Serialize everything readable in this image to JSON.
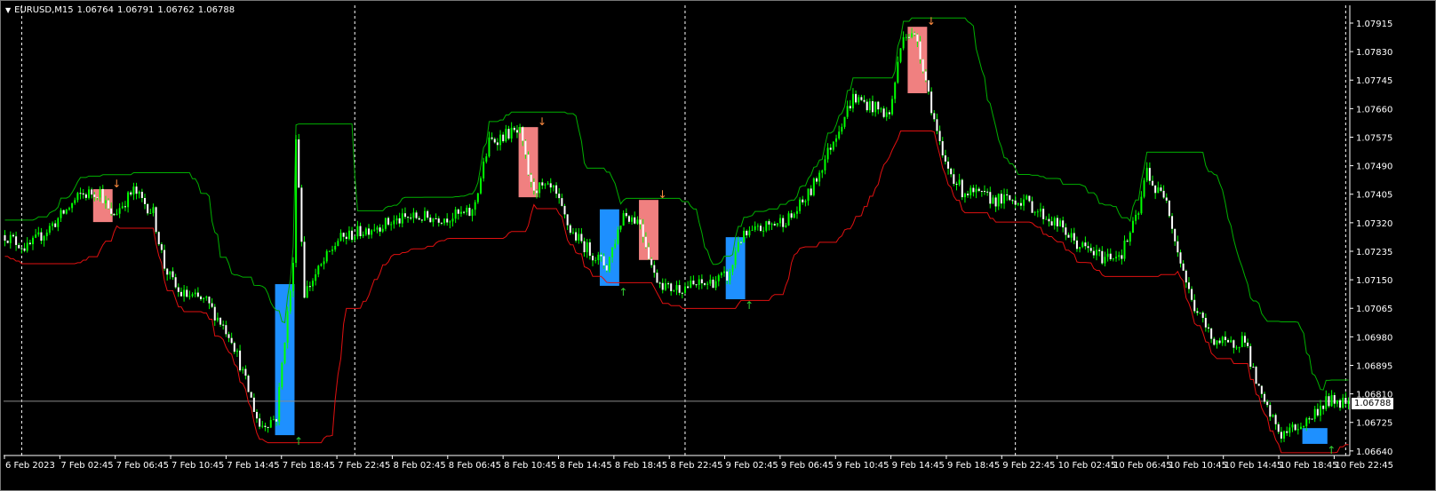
{
  "header": {
    "symbol": "EURUSD,M15",
    "open": "1.06764",
    "high": "1.06791",
    "low": "1.06762",
    "close": "1.06788"
  },
  "current_price_label": "1.06788",
  "colors": {
    "background": "#000000",
    "bull": "#00ff00",
    "bear": "#ffffff",
    "upper_channel": "#00b000",
    "lower_channel": "#e01010",
    "sell_zone": "#f08080",
    "buy_zone": "#1e90ff",
    "sell_arrow": "#ff8c40",
    "buy_arrow": "#32cd32",
    "grid": "#ffffff"
  },
  "chart_data": {
    "type": "candlestick",
    "title": "EURUSD,M15",
    "timeframe": "M15",
    "bars": 481,
    "ylim": [
      1.06625,
      1.07955
    ],
    "y_ticks": [
      "1.07915",
      "1.07830",
      "1.07745",
      "1.07660",
      "1.07575",
      "1.07490",
      "1.07405",
      "1.07320",
      "1.07235",
      "1.07150",
      "1.07065",
      "1.06980",
      "1.06895",
      "1.06810",
      "1.06725",
      "1.06640"
    ],
    "x_ticks": [
      "6 Feb 2023",
      "7 Feb 02:45",
      "7 Feb 06:45",
      "7 Feb 10:45",
      "7 Feb 14:45",
      "7 Feb 18:45",
      "7 Feb 22:45",
      "8 Feb 02:45",
      "8 Feb 06:45",
      "8 Feb 10:45",
      "8 Feb 14:45",
      "8 Feb 18:45",
      "8 Feb 22:45",
      "9 Feb 02:45",
      "9 Feb 06:45",
      "9 Feb 10:45",
      "9 Feb 14:45",
      "9 Feb 18:45",
      "9 Feb 22:45",
      "10 Feb 02:45",
      "10 Feb 06:45",
      "10 Feb 10:45",
      "10 Feb 14:45",
      "10 Feb 18:45",
      "10 Feb 22:45"
    ],
    "period_separators_bar": [
      6,
      125,
      243,
      361,
      479
    ],
    "price_path": [
      [
        0,
        1.07283
      ],
      [
        8,
        1.07243
      ],
      [
        18,
        1.07322
      ],
      [
        27,
        1.07402
      ],
      [
        34,
        1.07415
      ],
      [
        38,
        1.07336
      ],
      [
        46,
        1.07415
      ],
      [
        53,
        1.07349
      ],
      [
        57,
        1.0719
      ],
      [
        62,
        1.07111
      ],
      [
        72,
        1.07084
      ],
      [
        81,
        1.06978
      ],
      [
        91,
        1.06714
      ],
      [
        97,
        1.0674
      ],
      [
        100,
        1.06978
      ],
      [
        103,
        1.0719
      ],
      [
        104,
        1.07587
      ],
      [
        107,
        1.07111
      ],
      [
        113,
        1.0719
      ],
      [
        119,
        1.07269
      ],
      [
        132,
        1.07309
      ],
      [
        145,
        1.07336
      ],
      [
        157,
        1.07336
      ],
      [
        167,
        1.07349
      ],
      [
        173,
        1.0756
      ],
      [
        180,
        1.07587
      ],
      [
        184,
        1.07587
      ],
      [
        188,
        1.07428
      ],
      [
        196,
        1.07415
      ],
      [
        202,
        1.07296
      ],
      [
        208,
        1.07243
      ],
      [
        215,
        1.0719
      ],
      [
        221,
        1.07349
      ],
      [
        227,
        1.07322
      ],
      [
        232,
        1.07163
      ],
      [
        237,
        1.07124
      ],
      [
        250,
        1.07137
      ],
      [
        259,
        1.07163
      ],
      [
        262,
        1.07269
      ],
      [
        272,
        1.07309
      ],
      [
        281,
        1.07336
      ],
      [
        288,
        1.07415
      ],
      [
        297,
        1.07587
      ],
      [
        303,
        1.07693
      ],
      [
        310,
        1.07666
      ],
      [
        316,
        1.0764
      ],
      [
        321,
        1.07891
      ],
      [
        326,
        1.07865
      ],
      [
        329,
        1.07746
      ],
      [
        335,
        1.07508
      ],
      [
        342,
        1.07415
      ],
      [
        354,
        1.07388
      ],
      [
        364,
        1.07388
      ],
      [
        370,
        1.07349
      ],
      [
        377,
        1.07309
      ],
      [
        383,
        1.07256
      ],
      [
        392,
        1.07216
      ],
      [
        399,
        1.0723
      ],
      [
        405,
        1.07349
      ],
      [
        408,
        1.07481
      ],
      [
        411,
        1.07415
      ],
      [
        415,
        1.07402
      ],
      [
        418,
        1.07269
      ],
      [
        424,
        1.07084
      ],
      [
        431,
        1.06978
      ],
      [
        437,
        1.06952
      ],
      [
        443,
        1.06978
      ],
      [
        446,
        1.06872
      ],
      [
        449,
        1.06793
      ],
      [
        456,
        1.06687
      ],
      [
        465,
        1.06727
      ],
      [
        472,
        1.06788
      ],
      [
        480,
        1.06788
      ]
    ],
    "sell_zones": [
      [
        32,
        38,
        1.0742,
        1.07322
      ],
      [
        184,
        190,
        1.07605,
        1.07396
      ],
      [
        227,
        233,
        1.07388,
        1.07209
      ],
      [
        323,
        329,
        1.07904,
        1.07706
      ]
    ],
    "buy_zones": [
      [
        97,
        103,
        1.07137,
        1.06687
      ],
      [
        213,
        219,
        1.0736,
        1.07132
      ],
      [
        258,
        264,
        1.07277,
        1.07092
      ],
      [
        464,
        472,
        1.06708,
        1.06661
      ]
    ],
    "channel_period": 20,
    "current_price": 1.06788
  }
}
